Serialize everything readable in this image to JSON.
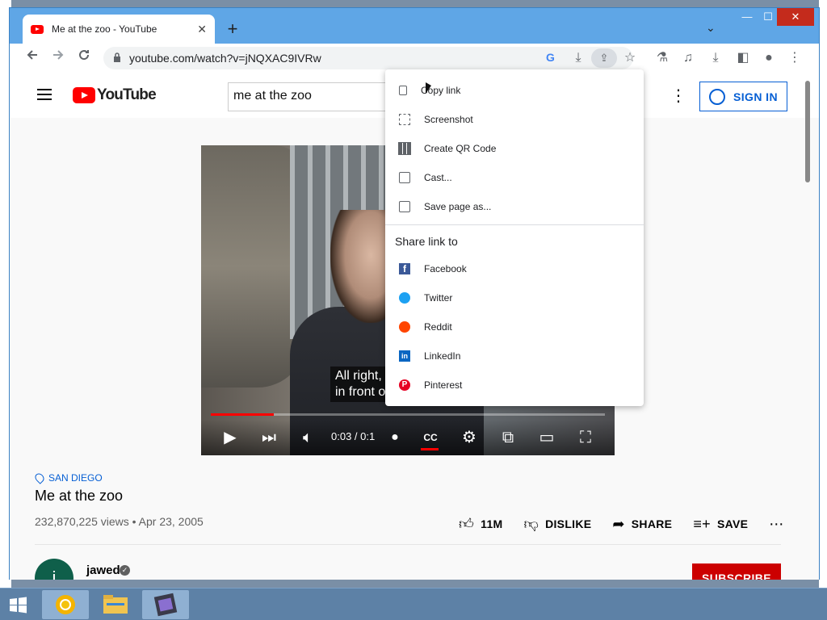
{
  "browser": {
    "tab_title": "Me at the zoo - YouTube",
    "url": "youtube.com/watch?v=jNQXAC9IVRw",
    "tab_close_glyph": "✕",
    "new_tab_glyph": "+",
    "tablist_glyph": "⌄",
    "window_controls": {
      "minimize": "—",
      "maximize": "☐",
      "close": "✕"
    }
  },
  "youtube": {
    "logo_text": "YouTube",
    "search_value": "me at the zoo",
    "sign_in_label": "SIGN IN",
    "caption_text": "All right,\nin front o",
    "time_display": "0:03 / 0:1",
    "progress_fraction": 0.16,
    "location": "SAN DIEGO",
    "video_title": "Me at the zoo",
    "meta": "232,870,225 views • Apr 23, 2005",
    "actions": {
      "like_count": "11M",
      "dislike_label": "DISLIKE",
      "share_label": "SHARE",
      "save_label": "SAVE"
    },
    "channel": {
      "avatar_letter": "i",
      "name": "jawed"
    },
    "subscribe_label": "SUBSCRIBE"
  },
  "share_menu": {
    "items": [
      {
        "label": "Copy link",
        "icon": "copy-icon"
      },
      {
        "label": "Screenshot",
        "icon": "screenshot-icon"
      },
      {
        "label": "Create QR Code",
        "icon": "qr-code-icon"
      },
      {
        "label": "Cast...",
        "icon": "cast-icon"
      },
      {
        "label": "Save page as...",
        "icon": "save-page-icon"
      }
    ],
    "heading": "Share link to",
    "targets": [
      {
        "label": "Facebook",
        "icon": "facebook-icon"
      },
      {
        "label": "Twitter",
        "icon": "twitter-icon"
      },
      {
        "label": "Reddit",
        "icon": "reddit-icon"
      },
      {
        "label": "LinkedIn",
        "icon": "linkedin-icon"
      },
      {
        "label": "Pinterest",
        "icon": "pinterest-icon"
      }
    ]
  },
  "colors": {
    "youtube_red": "#ff0000",
    "link_blue": "#065fd4",
    "subscribe_red": "#cc0000",
    "title_bar_blue": "#5fa6e6"
  }
}
